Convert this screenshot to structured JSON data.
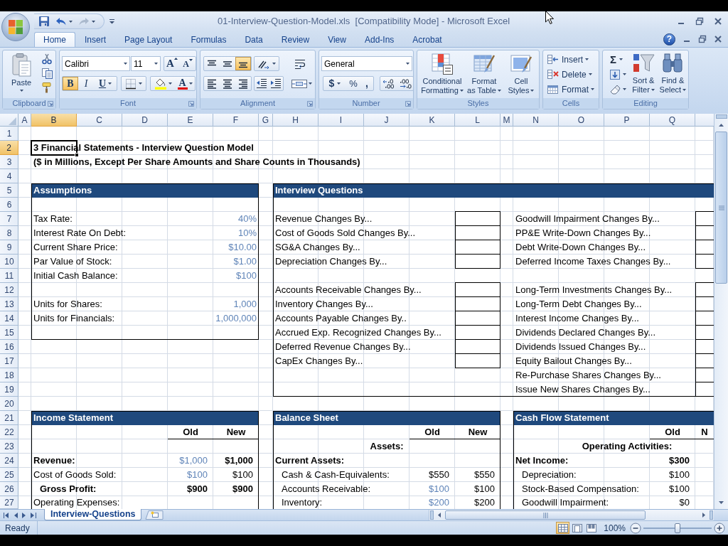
{
  "window": {
    "title": "01-Interview-Question-Model.xls  [Compatibility Mode] - Microsoft Excel"
  },
  "quick_access": [
    {
      "kind": "save",
      "disabled": false
    },
    {
      "kind": "undo",
      "disabled": false
    },
    {
      "kind": "redo",
      "disabled": true
    }
  ],
  "ribbon_tabs": [
    {
      "label": "Home",
      "selected": true
    },
    {
      "label": "Insert",
      "selected": false
    },
    {
      "label": "Page Layout",
      "selected": false
    },
    {
      "label": "Formulas",
      "selected": false
    },
    {
      "label": "Data",
      "selected": false
    },
    {
      "label": "Review",
      "selected": false
    },
    {
      "label": "View",
      "selected": false
    },
    {
      "label": "Add-Ins",
      "selected": false
    },
    {
      "label": "Acrobat",
      "selected": false
    }
  ],
  "help_button": "?",
  "ribbon": {
    "clipboard": {
      "label": "Clipboard",
      "paste": "Paste"
    },
    "font": {
      "label": "Font",
      "font_name": "Calibri",
      "font_size": "11",
      "grow_font": "A",
      "shrink_font": "A",
      "styles": [
        {
          "kind": "bold",
          "label": "B",
          "selected": true
        },
        {
          "kind": "italic",
          "label": "I",
          "selected": false
        },
        {
          "kind": "underline",
          "label": "U",
          "selected": false
        }
      ],
      "font_color": "A"
    },
    "alignment": {
      "label": "Alignment",
      "vertical": [
        {
          "kind": "top",
          "selected": false
        },
        {
          "kind": "middle",
          "selected": false
        },
        {
          "kind": "bottom",
          "selected": true
        }
      ],
      "horizontal": [
        {
          "kind": "left",
          "selected": false
        },
        {
          "kind": "center",
          "selected": false
        },
        {
          "kind": "right",
          "selected": false
        }
      ]
    },
    "number": {
      "label": "Number",
      "format": "General",
      "currency": "$",
      "percent": "%",
      "comma": ","
    },
    "styles": {
      "label": "Styles",
      "buttons": [
        {
          "kind": "conditional",
          "lines": [
            "Conditional",
            "Formatting"
          ]
        },
        {
          "kind": "table",
          "lines": [
            "Format",
            "as Table"
          ]
        },
        {
          "kind": "cell_styles",
          "lines": [
            "Cell",
            "Styles"
          ]
        }
      ]
    },
    "cells": {
      "label": "Cells",
      "buttons": [
        {
          "kind": "insert",
          "label": "Insert"
        },
        {
          "kind": "delete",
          "label": "Delete"
        },
        {
          "kind": "format",
          "label": "Format"
        }
      ]
    },
    "editing": {
      "label": "Editing",
      "autosum": "Σ",
      "buttons": [
        {
          "kind": "sort",
          "lines": [
            "Sort &",
            "Filter"
          ]
        },
        {
          "kind": "find",
          "lines": [
            "Find &",
            "Select"
          ]
        }
      ]
    }
  },
  "sheet": {
    "columns": [
      {
        "label": "A",
        "selected": false
      },
      {
        "label": "B",
        "selected": true
      },
      {
        "label": "C",
        "selected": false
      },
      {
        "label": "D",
        "selected": false
      },
      {
        "label": "E",
        "selected": false
      },
      {
        "label": "F",
        "selected": false
      },
      {
        "label": "G",
        "selected": false
      },
      {
        "label": "H",
        "selected": false
      },
      {
        "label": "I",
        "selected": false
      },
      {
        "label": "J",
        "selected": false
      },
      {
        "label": "K",
        "selected": false
      },
      {
        "label": "L",
        "selected": false
      },
      {
        "label": "M",
        "selected": false
      },
      {
        "label": "N",
        "selected": false
      },
      {
        "label": "O",
        "selected": false
      },
      {
        "label": "P",
        "selected": false
      },
      {
        "label": "Q",
        "selected": false
      }
    ],
    "rows": [
      {
        "label": "1",
        "selected": false
      },
      {
        "label": "2",
        "selected": true
      },
      {
        "label": "3",
        "selected": false
      },
      {
        "label": "4",
        "selected": false
      },
      {
        "label": "5",
        "selected": false
      },
      {
        "label": "6",
        "selected": false
      },
      {
        "label": "7",
        "selected": false
      },
      {
        "label": "8",
        "selected": false
      },
      {
        "label": "9",
        "selected": false
      },
      {
        "label": "10",
        "selected": false
      },
      {
        "label": "11",
        "selected": false
      },
      {
        "label": "12",
        "selected": false
      },
      {
        "label": "13",
        "selected": false
      },
      {
        "label": "14",
        "selected": false
      },
      {
        "label": "15",
        "selected": false
      },
      {
        "label": "16",
        "selected": false
      },
      {
        "label": "17",
        "selected": false
      },
      {
        "label": "18",
        "selected": false
      },
      {
        "label": "19",
        "selected": false
      },
      {
        "label": "20",
        "selected": false
      },
      {
        "label": "21",
        "selected": false
      },
      {
        "label": "22",
        "selected": false
      },
      {
        "label": "23",
        "selected": false
      },
      {
        "label": "24",
        "selected": false
      },
      {
        "label": "25",
        "selected": false
      },
      {
        "label": "26",
        "selected": false
      },
      {
        "label": "27",
        "selected": false
      }
    ],
    "title": "3 Financial Statements - Interview Question Model",
    "subtitle": "($ in Millions, Except Per Share Amounts and Share Counts in Thousands)",
    "assumptions": {
      "title": "Assumptions",
      "groups": [
        [
          {
            "label": "Tax Rate:",
            "value": "40%",
            "input": true
          },
          {
            "label": "Interest Rate On Debt:",
            "value": "10%",
            "input": true
          },
          {
            "label": "Current Share Price:",
            "value": "$10.00",
            "input": true
          },
          {
            "label": "Par Value of Stock:",
            "value": "$1.00",
            "input": true
          },
          {
            "label": "Initial Cash Balance:",
            "value": "$100",
            "input": true
          }
        ],
        [
          {
            "label": "Units for Shares:",
            "value": "1,000",
            "input": true
          },
          {
            "label": "Units for Financials:",
            "value": "1,000,000",
            "input": true
          }
        ]
      ]
    },
    "interview_questions": {
      "title": "Interview Questions",
      "columns": [
        [
          [
            "Revenue Changes By...",
            "Cost of Goods Sold Changes By...",
            "SG&A Changes By...",
            "Depreciation Changes By..."
          ],
          [
            "Accounts Receivable Changes By...",
            "Inventory Changes By...",
            "Accounts Payable Changes By..",
            "Accrued Exp. Recognized Changes By...",
            "Deferred Revenue Changes By...",
            "CapEx Changes By..."
          ]
        ],
        [
          [
            "Goodwill Impairment Changes By...",
            "PP&E Write-Down Changes By...",
            "Debt Write-Down Changes By...",
            "Deferred Income Taxes Changes By..."
          ],
          [
            "Long-Term Investments Changes By...",
            "Long-Term Debt Changes By...",
            "Interest Income Changes By...",
            "Dividends Declared Changes By...",
            "Dividends Issued Changes By...",
            "Equity Bailout Changes By...",
            "Re-Purchase Shares Changes By...",
            "Issue New Shares Changes By..."
          ]
        ]
      ]
    },
    "statements": [
      {
        "title": "Income Statement",
        "old_label": "Old",
        "new_label": "New",
        "rows": [
          {
            "label": "Revenue:",
            "old": "$1,000",
            "new": "$1,000",
            "bold": true,
            "indented": false,
            "old_input": true
          },
          {
            "label": "Cost of Goods Sold:",
            "old": "$100",
            "new": "$100",
            "bold": false,
            "indented": false,
            "old_input": true
          },
          {
            "label": "Gross Profit:",
            "old": "$900",
            "new": "$900",
            "bold": true,
            "indented": true,
            "old_input": false
          },
          {
            "label": "Operating Expenses:",
            "bold": false,
            "indented": false
          }
        ]
      },
      {
        "title": "Balance Sheet",
        "old_label": "Old",
        "new_label": "New",
        "heading": "Assets:",
        "rows": [
          {
            "label": "Current Assets:",
            "bold": true,
            "indented": false
          },
          {
            "label": "Cash & Cash-Equivalents:",
            "old": "$550",
            "new": "$550",
            "bold": false,
            "indented": true,
            "old_input": false
          },
          {
            "label": "Accounts Receivable:",
            "old": "$100",
            "new": "$100",
            "bold": false,
            "indented": true,
            "old_input": true
          },
          {
            "label": "Inventory:",
            "old": "$200",
            "new": "$200",
            "bold": false,
            "indented": true,
            "old_input": true
          }
        ]
      },
      {
        "title": "Cash Flow Statement",
        "old_label": "Old",
        "new_label": "N",
        "heading": "Operating Activities:",
        "rows": [
          {
            "label": "Net Income:",
            "old": "$300",
            "bold": true,
            "indented": false,
            "old_input": false
          },
          {
            "label": "Depreciation:",
            "old": "$100",
            "bold": false,
            "indented": true,
            "old_input": false
          },
          {
            "label": "Stock-Based Compensation:",
            "old": "$100",
            "bold": false,
            "indented": true,
            "old_input": false
          },
          {
            "label": "Goodwill Impairment:",
            "old": "$0",
            "bold": false,
            "indented": true,
            "old_input": false
          }
        ]
      }
    ]
  },
  "sheet_tabs": [
    {
      "label": "Interview-Questions",
      "selected": true
    }
  ],
  "status_bar": {
    "status": "Ready",
    "views": [
      {
        "kind": "normal",
        "selected": true
      },
      {
        "kind": "page_layout",
        "selected": false
      },
      {
        "kind": "page_break",
        "selected": false
      }
    ],
    "zoom": {
      "label": "100%",
      "level": 0.5
    }
  }
}
